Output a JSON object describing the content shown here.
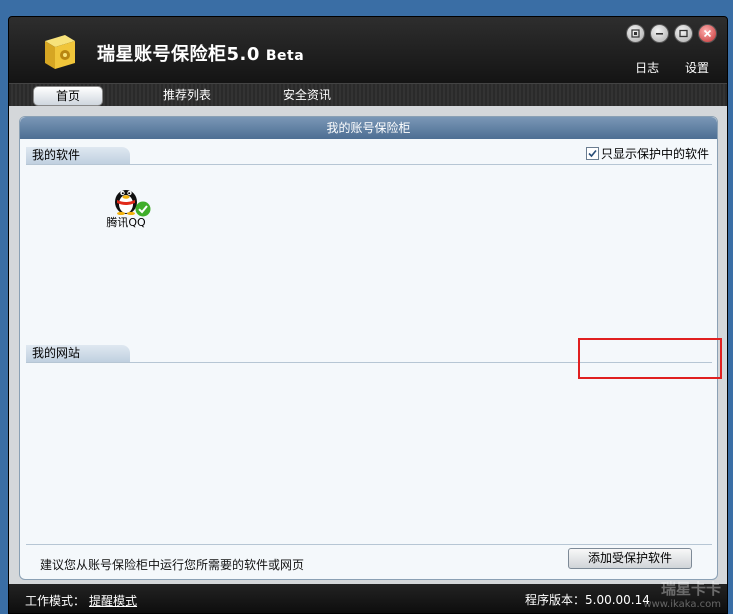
{
  "app": {
    "title": "瑞星账号保险柜5.0",
    "beta": "Beta"
  },
  "top_links": {
    "log": "日志",
    "settings": "设置"
  },
  "nav": {
    "tabs": [
      {
        "label": "首页"
      },
      {
        "label": "推荐列表"
      },
      {
        "label": "安全资讯"
      }
    ]
  },
  "panel": {
    "title": "我的账号保险柜",
    "software_section": "我的软件",
    "website_section": "我的网站",
    "only_protected_label": "只显示保护中的软件",
    "apps": [
      {
        "label": "腾讯QQ"
      }
    ],
    "hint": "建议您从账号保险柜中运行您所需要的软件或网页",
    "add_button": "添加受保护软件"
  },
  "status": {
    "mode_label": "工作模式：",
    "mode_value": "提醒模式",
    "version": "程序版本：5.00.00.14"
  },
  "watermark": {
    "brand": "瑞星卡卡",
    "url": "www.ikaka.com"
  },
  "colors": {
    "accent_red": "#e02020",
    "header_blue": "#5a7ba0"
  }
}
